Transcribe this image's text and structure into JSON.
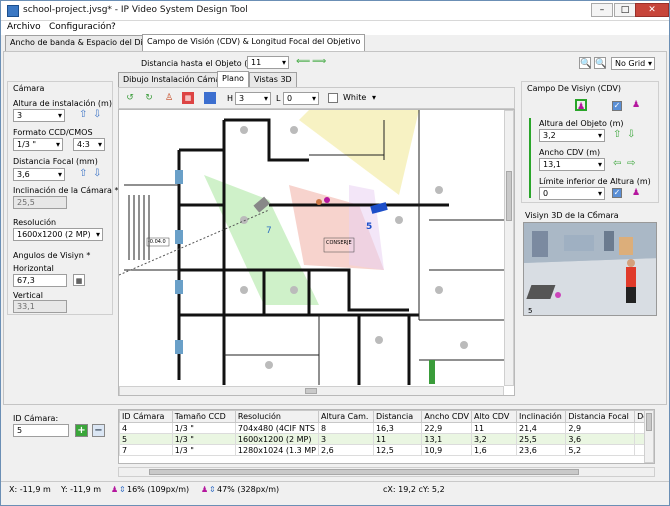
{
  "window": {
    "title": "school-project.jvsg* - IP Video System Design Tool"
  },
  "menu": {
    "archivo": "Archivo",
    "configuracion": "Configuración",
    "help": "?"
  },
  "tabs": {
    "bandwidth": "Ancho de banda & Espacio del Disco",
    "fov": "Campo de Visión (CDV) & Longitud Focal del Objetivo"
  },
  "distance": {
    "label": "Distancia hasta el Objeto (m)",
    "value": "11"
  },
  "grid_select": "No Grid",
  "camera": {
    "group": "Cámara",
    "height_label": "Altura de instalación (m)",
    "height_value": "3",
    "format_label": "Formato CCD/CMOS",
    "format_value": "1/3 \"",
    "aspect_value": "4:3",
    "focal_label": "Distancia Focal (mm)",
    "focal_value": "3,6",
    "tilt_label": "Inclinación de la Cámara *",
    "tilt_value": "25,5",
    "res_label": "Resolución",
    "res_value": "1600x1200 (2 MP)",
    "angles_label": "Angulos de Visiуn *",
    "horizontal_label": "Horizontal",
    "horizontal_value": "67,3",
    "vertical_label": "Vertical",
    "vertical_value": "33,1"
  },
  "subtabs": {
    "install": "Dibujo Instalación Cámara",
    "plan": "Plano",
    "views3d": "Vistas 3D"
  },
  "draw_toolbar": {
    "h_label": "H",
    "h_value": "3",
    "l_label": "L",
    "l_value": "0",
    "color_label": "White"
  },
  "plan_labels": {
    "cam7": "7",
    "cam5": "5",
    "mark1": "-0.04.0",
    "mark2": "CONSERJE"
  },
  "fov_panel": {
    "title": "Campo De Visiуn (CDV)",
    "object_height_label": "Altura del Objeto (m)",
    "object_height_value": "3,2",
    "width_label": "Ancho CDV (m)",
    "width_value": "13,1",
    "limit_label": "Límite inferior de Altura (m)",
    "limit_value": "0"
  },
  "view3d": {
    "title": "Visiуn 3D de la Cбmara",
    "cam_label": "5"
  },
  "camera_id": {
    "label": "ID Cámara:",
    "value": "5"
  },
  "table": {
    "columns": [
      "ID Cámara",
      "Tamaño CCD",
      "Resolución",
      "Altura Cam.",
      "Distancia",
      "Ancho CDV",
      "Alto CDV",
      "Inclinación",
      "Distancia Focal",
      "De"
    ],
    "rows": [
      [
        "4",
        "1/3 \"",
        "704x480 (4CIF NTS",
        "8",
        "16,3",
        "22,9",
        "11",
        "21,4",
        "2,9",
        ""
      ],
      [
        "5",
        "1/3 \"",
        "1600x1200 (2 MP)",
        "3",
        "11",
        "13,1",
        "3,2",
        "25,5",
        "3,6",
        ""
      ],
      [
        "7",
        "1/3 \"",
        "1280x1024 (1.3 MP",
        "2,6",
        "12,5",
        "10,9",
        "1,6",
        "23,6",
        "5,2",
        ""
      ]
    ]
  },
  "status": {
    "x": "X: -11,9 m",
    "y": "Y: -11,9 m",
    "density1": "16% (109px/m)",
    "density2": "47% (328px/m)",
    "cx": "cX: 19,2 cY: 5,2"
  }
}
